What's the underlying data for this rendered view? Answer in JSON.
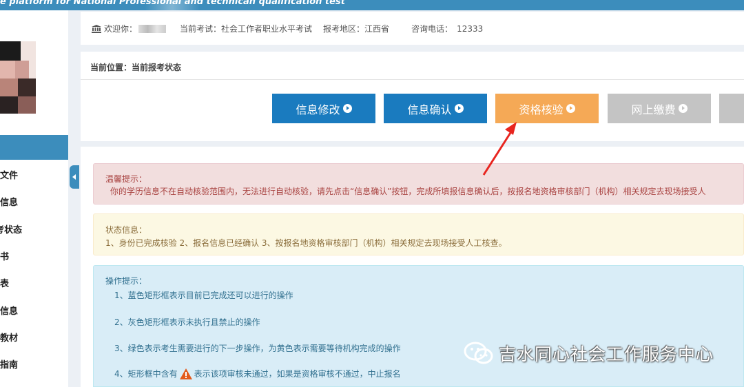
{
  "topbar": {
    "title": "e platform for National Professional and technican qualification test"
  },
  "header": {
    "welcome_label": "欢迎你：",
    "exam_label": "当前考试：社会工作者职业水平考试",
    "region_label": "报考地区：江西省",
    "phone_label": "咨询电话：",
    "phone_value": "12333"
  },
  "sidebar": {
    "items": [
      {
        "label": "文件"
      },
      {
        "label": "信息"
      },
      {
        "label": "考状态"
      },
      {
        "label": "书"
      },
      {
        "label": "表"
      },
      {
        "label": "信息"
      },
      {
        "label": "教材"
      },
      {
        "label": "指南"
      }
    ]
  },
  "breadcrumb": {
    "text": "当前位置：当前报考状态"
  },
  "steps": [
    {
      "label": "信息修改",
      "color": "#1a7bbf"
    },
    {
      "label": "信息确认",
      "color": "#1a7bbf"
    },
    {
      "label": "资格核验",
      "color": "#f5a956"
    },
    {
      "label": "网上缴费",
      "color": "#c4c4c4"
    }
  ],
  "notice": {
    "title": "温馨提示：",
    "text": "你的学历信息不在自动核验范围内，无法进行自动核验，请先点击“信息确认”按钮，完成所填报信息确认后，按报名地资格审核部门（机构）相关规定去现场接受人"
  },
  "status": {
    "title": "状态信息：",
    "text": "1、身份已完成核验 2、报名信息已经确认 3、按报名地资格审核部门（机构）相关规定去现场接受人工核查。"
  },
  "ops": {
    "title": "操作提示：",
    "items": [
      "1、蓝色矩形框表示目前已完成还可以进行的操作",
      "2、灰色矩形框表示未执行且禁止的操作",
      "3、绿色表示考生需要进行的下一步操作，为黄色表示需要等待机构完成的操作"
    ],
    "item4_before": "4、矩形框中含有",
    "item4_after": "表示该项审核未通过，如果是资格审核不通过，中止报名"
  },
  "watermark": {
    "text": "吉水同心社会工作服务中心"
  },
  "colors": {
    "brand_blue": "#3c8dbc",
    "notice_bg": "#f2dede",
    "status_bg": "#fcf8e3",
    "ops_bg": "#d9edf7",
    "arrow_red": "#e8251f"
  }
}
